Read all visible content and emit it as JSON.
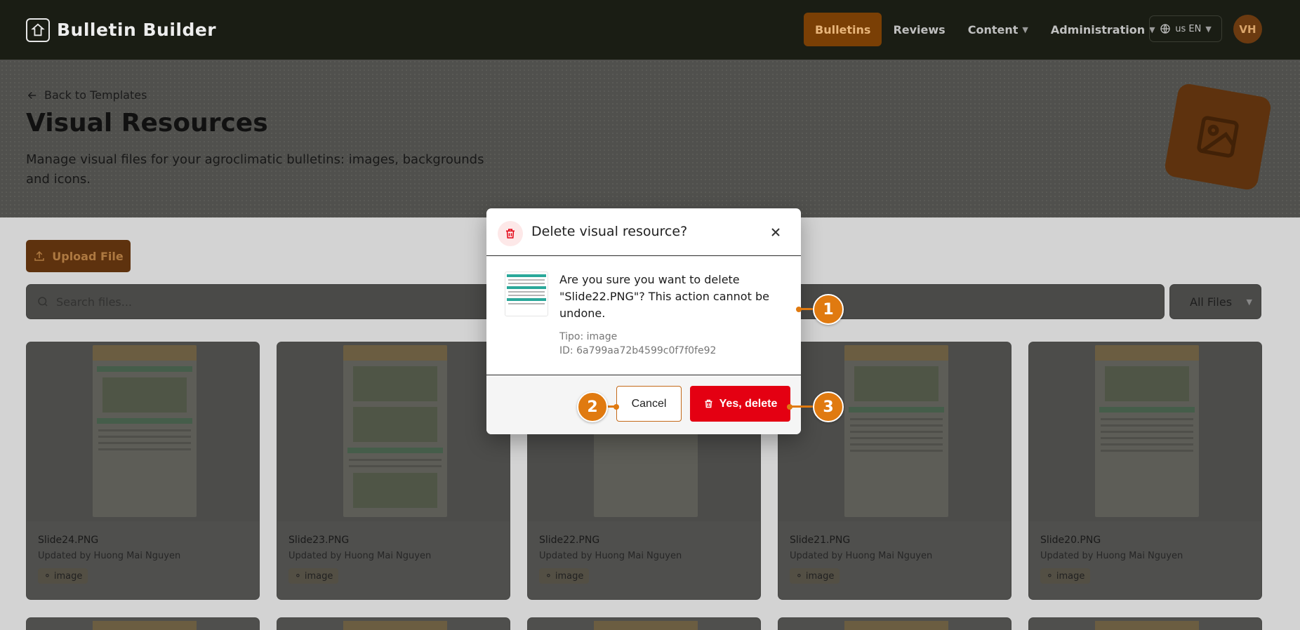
{
  "nav": {
    "brand": "Bulletin Builder",
    "items": [
      {
        "label": "Bulletins",
        "active": true,
        "dropdown": false
      },
      {
        "label": "Reviews",
        "active": false,
        "dropdown": false
      },
      {
        "label": "Content",
        "active": false,
        "dropdown": true
      },
      {
        "label": "Administration",
        "active": false,
        "dropdown": true
      }
    ],
    "language": "us EN",
    "user_initials": "VH"
  },
  "hero": {
    "back_label": "Back to Templates",
    "title": "Visual Resources",
    "subtitle": "Manage visual files for your agroclimatic bulletins: images, backgrounds and icons."
  },
  "toolbar": {
    "upload_label": "Upload File",
    "search_placeholder": "Search files...",
    "filter_value": "All Files"
  },
  "cards": [
    {
      "name": "Slide24.PNG",
      "meta": "Updated by Huong Mai Nguyen",
      "tag": "image"
    },
    {
      "name": "Slide23.PNG",
      "meta": "Updated by Huong Mai Nguyen",
      "tag": "image"
    },
    {
      "name": "Slide22.PNG",
      "meta": "Updated by Huong Mai Nguyen",
      "tag": "image"
    },
    {
      "name": "Slide21.PNG",
      "meta": "Updated by Huong Mai Nguyen",
      "tag": "image"
    },
    {
      "name": "Slide20.PNG",
      "meta": "Updated by Huong Mai Nguyen",
      "tag": "image"
    }
  ],
  "modal": {
    "title": "Delete visual resource?",
    "message": "Are you sure you want to delete \"Slide22.PNG\"? This action cannot be undone.",
    "type_line": "Tipo: image",
    "id_line": "ID: 6a799aa72b4599c0f7f0fe92",
    "cancel_label": "Cancel",
    "delete_label": "Yes, delete"
  },
  "callouts": [
    "1",
    "2",
    "3"
  ],
  "colors": {
    "accent": "#e07a10",
    "danger": "#e40012",
    "nav_bg": "#1a1d14",
    "active_nav": "#7a3f05"
  }
}
